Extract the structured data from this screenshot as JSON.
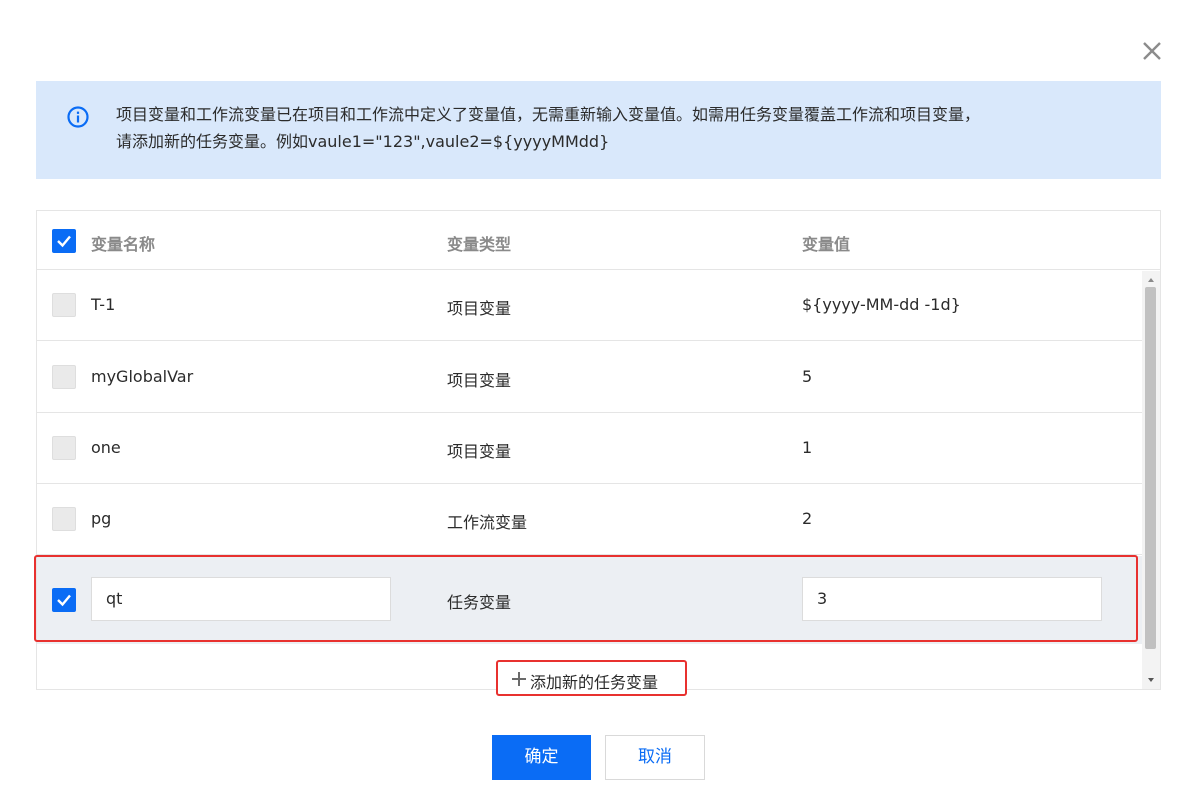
{
  "notice": {
    "line1": "项目变量和工作流变量已在项目和工作流中定义了变量值，无需重新输入变量值。如需用任务变量覆盖工作流和项目变量，",
    "line2": "请添加新的任务变量。例如vaule1=\"123\",vaule2=${yyyyMMdd}"
  },
  "table": {
    "headers": {
      "name": "变量名称",
      "type": "变量类型",
      "value": "变量值"
    },
    "header_checked": true,
    "rows": [
      {
        "name": "T-1",
        "type": "项目变量",
        "value": "${yyyy-MM-dd -1d}",
        "checked": false
      },
      {
        "name": "myGlobalVar",
        "type": "项目变量",
        "value": "5",
        "checked": false
      },
      {
        "name": "one",
        "type": "项目变量",
        "value": "1",
        "checked": false
      },
      {
        "name": "pg",
        "type": "工作流变量",
        "value": "2",
        "checked": false
      },
      {
        "name": "qt",
        "type": "任务变量",
        "value": "3",
        "checked": true,
        "editable": true
      }
    ]
  },
  "add_button": {
    "label": "添加新的任务变量"
  },
  "footer": {
    "confirm_label": "确定",
    "cancel_label": "取消"
  },
  "colors": {
    "primary": "#0a6cf5",
    "highlight_border": "#e8312f",
    "notice_bg": "#d9e8fb"
  },
  "icons": {
    "close": "close-icon",
    "info": "info-icon",
    "check": "check-icon",
    "plus": "plus-icon"
  }
}
